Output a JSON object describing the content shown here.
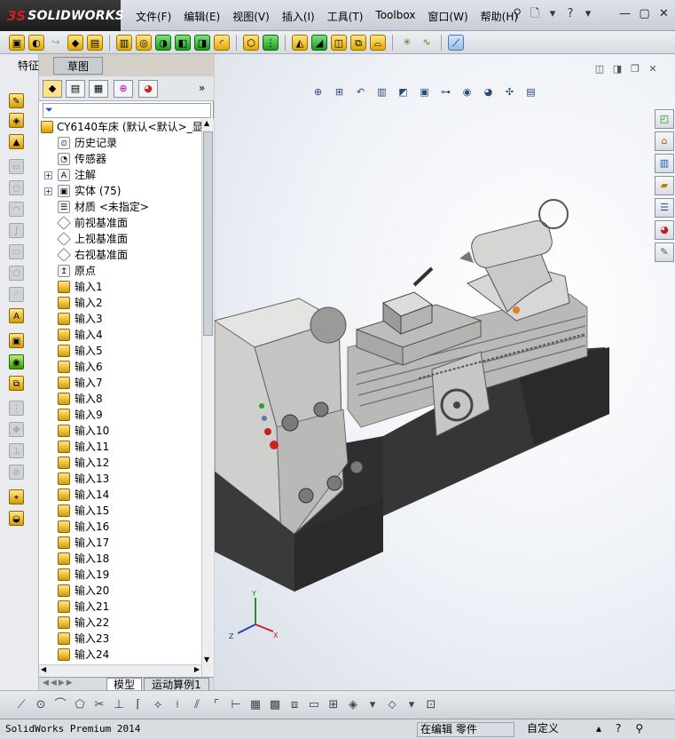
{
  "app": {
    "logo_ds": "3S",
    "logo_name": "SOLIDWORKS"
  },
  "menu": [
    "文件(F)",
    "编辑(E)",
    "视图(V)",
    "插入(I)",
    "工具(T)",
    "Toolbox",
    "窗口(W)",
    "帮助(H)"
  ],
  "tabs": {
    "features": "特征",
    "sketch": "草图"
  },
  "tree": {
    "root": "CY6140车床  (默认<默认>_显",
    "items": [
      {
        "label": "历史记录",
        "icon": "history-icon",
        "expandable": false
      },
      {
        "label": "传感器",
        "icon": "sensor-icon",
        "expandable": false
      },
      {
        "label": "注解",
        "icon": "annotation-icon",
        "expandable": true
      },
      {
        "label": "实体 (75)",
        "icon": "solid-bodies-icon",
        "expandable": true
      },
      {
        "label": "材质 <未指定>",
        "icon": "material-icon",
        "expandable": false
      },
      {
        "label": "前视基准面",
        "icon": "plane-icon",
        "expandable": false
      },
      {
        "label": "上视基准面",
        "icon": "plane-icon",
        "expandable": false
      },
      {
        "label": "右视基准面",
        "icon": "plane-icon",
        "expandable": false
      },
      {
        "label": "原点",
        "icon": "origin-icon",
        "expandable": false
      }
    ],
    "imports": [
      "输入1",
      "输入2",
      "输入3",
      "输入4",
      "输入5",
      "输入6",
      "输入7",
      "输入8",
      "输入9",
      "输入10",
      "输入11",
      "输入12",
      "输入13",
      "输入14",
      "输入15",
      "输入16",
      "输入17",
      "输入18",
      "输入19",
      "输入20",
      "输入21",
      "输入22",
      "输入23",
      "输入24"
    ]
  },
  "bottom_tabs": {
    "model": "模型",
    "motion": "运动算例1"
  },
  "status": {
    "product": "SolidWorks Premium 2014",
    "editing": "在编辑 零件",
    "units": "自定义"
  },
  "triad": {
    "x": "X",
    "y": "Y",
    "z": "Z"
  },
  "colors": {
    "accent_yellow": "#e0a800",
    "logo_red": "#d21f1f",
    "lathe_body": "#c9c9c7",
    "lathe_base": "#2e2e2e"
  }
}
